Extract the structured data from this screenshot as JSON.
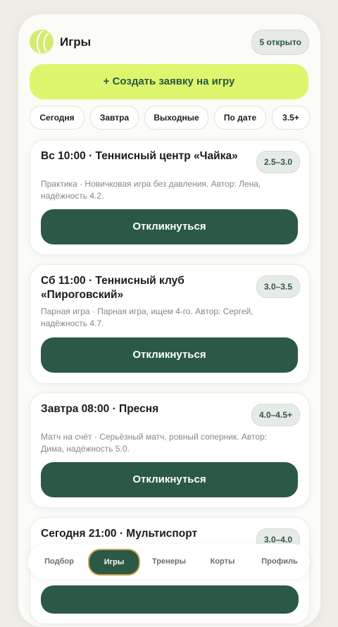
{
  "header": {
    "title": "Игры",
    "open_count": "5 открыто"
  },
  "create_button": "+ Создать заявку на игру",
  "filters": [
    "Сегодня",
    "Завтра",
    "Выходные",
    "По дате",
    "3.5+"
  ],
  "games": [
    {
      "title": "Вс 10:00 · Теннисный центр «Чайка»",
      "level": "2.5–3.0",
      "description": "Практика · Новичковая игра без давления. Автор: Лена, надёжность 4.2.",
      "action": "Откликнуться"
    },
    {
      "title": "Сб 11:00 · Теннисный клуб «Пироговский»",
      "level": "3.0–3.5",
      "description": "Парная игра · Парная игра, ищем 4-го. Автор: Сергей, надёжность 4.7.",
      "action": "Откликнуться"
    },
    {
      "title": "Завтра 08:00 · Пресня",
      "level": "4.0–4.5+",
      "description": "Матч на счёт · Серьёзный матч, ровный соперник. Автор: Дима, надёжность 5.0.",
      "action": "Откликнуться"
    },
    {
      "title": "Сегодня 21:00 · Мультиспорт",
      "level": "3.0–4.0"
    }
  ],
  "tabs": [
    "Подбор",
    "Игры",
    "Тренеры",
    "Корты",
    "Профиль"
  ],
  "active_tab": "Игры",
  "colors": {
    "accent": "#2b5945",
    "lime": "#ddf66d",
    "gold": "#c9a44a"
  }
}
